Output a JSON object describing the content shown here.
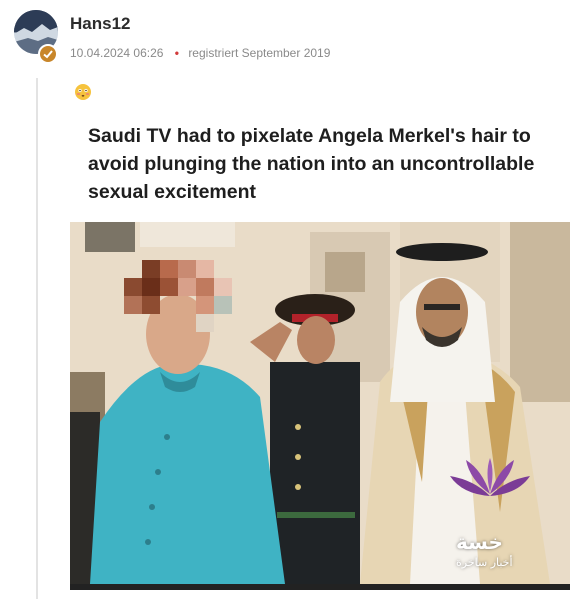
{
  "post": {
    "username": "Hans12",
    "timestamp": "10.04.2024 06:26",
    "registered": "registriert September 2019",
    "emoji_name": "flushed-face-emoji"
  },
  "meme": {
    "caption": "Saudi TV had to pixelate Angela Merkel's hair to avoid plunging the nation into an uncontrollable sexual excitement",
    "watermark_title": "خسة",
    "watermark_subtitle": "أخبار ساخرة"
  },
  "colors": {
    "accent_dot": "#d23b3b",
    "badge": "#c8862a",
    "turquoise_jacket": "#3fb3c4"
  }
}
